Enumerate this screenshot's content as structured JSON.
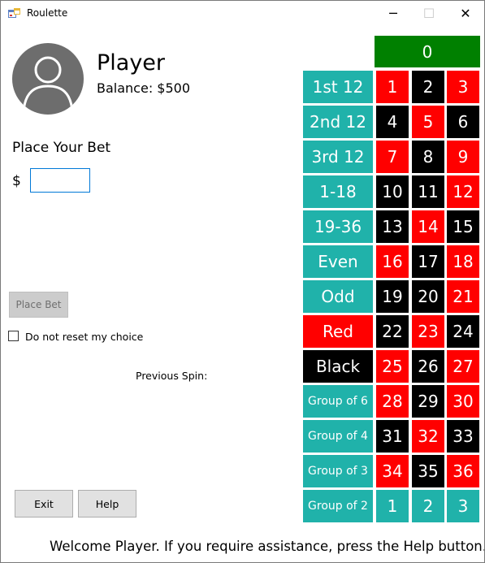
{
  "window": {
    "title": "Roulette",
    "minimize_glyph": "─",
    "maximize_glyph": "☐",
    "close_glyph": "✕"
  },
  "player": {
    "name": "Player",
    "balance_label": "Balance: $500",
    "avatar_icon": "user-silhouette-icon"
  },
  "bet": {
    "prompt": "Place Your Bet",
    "currency": "$",
    "amount_value": "",
    "place_bet_label": "Place Bet"
  },
  "options": {
    "reset_choice_label": "Do not reset my choice",
    "reset_choice_checked": false
  },
  "previous_spin": {
    "label": "Previous Spin:"
  },
  "buttons": {
    "exit_label": "Exit",
    "help_label": "Help"
  },
  "status": {
    "message": "Welcome Player. If you require assistance, press the Help button."
  },
  "colors": {
    "green": "#008000",
    "red": "#ff0000",
    "black": "#000000",
    "teal": "#20b2aa",
    "avatar": "#6d6d6d"
  },
  "board": {
    "zero": "0",
    "side_bets": [
      {
        "label": "1st 12",
        "color": "teal",
        "size": "big"
      },
      {
        "label": "2nd 12",
        "color": "teal",
        "size": "big"
      },
      {
        "label": "3rd 12",
        "color": "teal",
        "size": "big"
      },
      {
        "label": "1-18",
        "color": "teal",
        "size": "big"
      },
      {
        "label": "19-36",
        "color": "teal",
        "size": "big"
      },
      {
        "label": "Even",
        "color": "teal",
        "size": "big"
      },
      {
        "label": "Odd",
        "color": "teal",
        "size": "big"
      },
      {
        "label": "Red",
        "color": "red",
        "size": "big"
      },
      {
        "label": "Black",
        "color": "black",
        "size": "big"
      },
      {
        "label": "Group of 6",
        "color": "teal",
        "size": "small"
      },
      {
        "label": "Group of 4",
        "color": "teal",
        "size": "small"
      },
      {
        "label": "Group of 3",
        "color": "teal",
        "size": "small"
      },
      {
        "label": "Group of 2",
        "color": "teal",
        "size": "small"
      }
    ],
    "rows": [
      [
        {
          "n": "1",
          "c": "red"
        },
        {
          "n": "2",
          "c": "black"
        },
        {
          "n": "3",
          "c": "red"
        }
      ],
      [
        {
          "n": "4",
          "c": "black"
        },
        {
          "n": "5",
          "c": "red"
        },
        {
          "n": "6",
          "c": "black"
        }
      ],
      [
        {
          "n": "7",
          "c": "red"
        },
        {
          "n": "8",
          "c": "black"
        },
        {
          "n": "9",
          "c": "red"
        }
      ],
      [
        {
          "n": "10",
          "c": "black"
        },
        {
          "n": "11",
          "c": "black"
        },
        {
          "n": "12",
          "c": "red"
        }
      ],
      [
        {
          "n": "13",
          "c": "black"
        },
        {
          "n": "14",
          "c": "red"
        },
        {
          "n": "15",
          "c": "black"
        }
      ],
      [
        {
          "n": "16",
          "c": "red"
        },
        {
          "n": "17",
          "c": "black"
        },
        {
          "n": "18",
          "c": "red"
        }
      ],
      [
        {
          "n": "19",
          "c": "black"
        },
        {
          "n": "20",
          "c": "black"
        },
        {
          "n": "21",
          "c": "red"
        }
      ],
      [
        {
          "n": "22",
          "c": "black"
        },
        {
          "n": "23",
          "c": "red"
        },
        {
          "n": "24",
          "c": "black"
        }
      ],
      [
        {
          "n": "25",
          "c": "red"
        },
        {
          "n": "26",
          "c": "black"
        },
        {
          "n": "27",
          "c": "red"
        }
      ],
      [
        {
          "n": "28",
          "c": "red"
        },
        {
          "n": "29",
          "c": "black"
        },
        {
          "n": "30",
          "c": "red"
        }
      ],
      [
        {
          "n": "31",
          "c": "black"
        },
        {
          "n": "32",
          "c": "red"
        },
        {
          "n": "33",
          "c": "black"
        }
      ],
      [
        {
          "n": "34",
          "c": "red"
        },
        {
          "n": "35",
          "c": "black"
        },
        {
          "n": "36",
          "c": "red"
        }
      ],
      [
        {
          "n": "1",
          "c": "teal"
        },
        {
          "n": "2",
          "c": "teal"
        },
        {
          "n": "3",
          "c": "teal"
        }
      ]
    ]
  }
}
